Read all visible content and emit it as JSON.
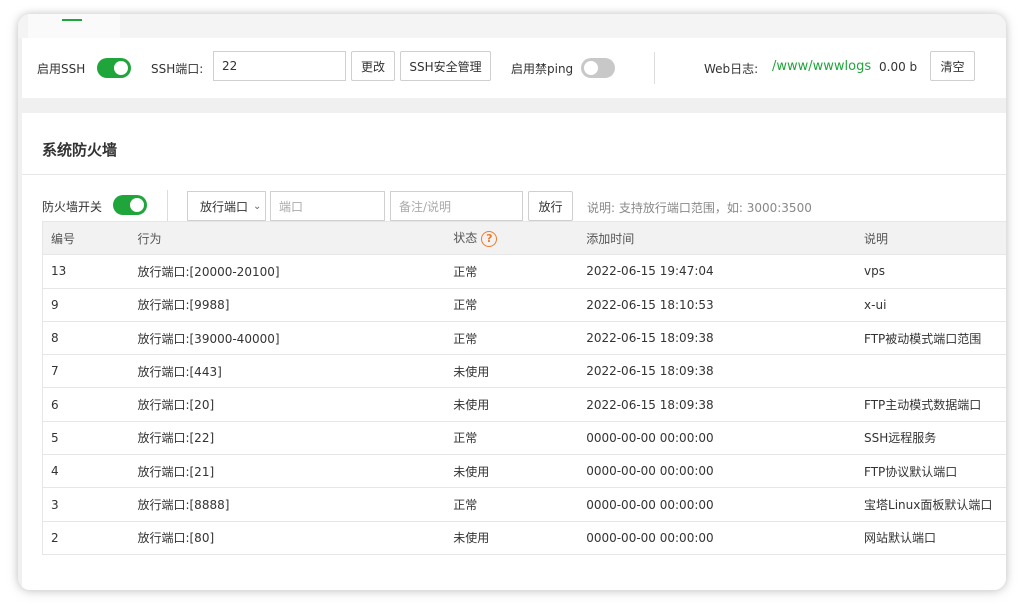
{
  "ssh": {
    "enable_label": "启用SSH",
    "enabled": true,
    "port_label": "SSH端口:",
    "port_value": "22",
    "change_label": "更改",
    "manage_label": "SSH安全管理",
    "ping_label": "启用禁ping",
    "ping_enabled": false
  },
  "weblog": {
    "label": "Web日志:",
    "path": "/www/wwwlogs",
    "size": "0.00 b",
    "clear_label": "清空"
  },
  "firewall": {
    "title": "系统防火墙",
    "switch_label": "防火墙开关",
    "enabled": true,
    "action_select": "放行端口",
    "port_placeholder": "端口",
    "remark_placeholder": "备注/说明",
    "submit_label": "放行",
    "hint": "说明: 支持放行端口范围，如: 3000:3500"
  },
  "table": {
    "headers": [
      "编号",
      "行为",
      "状态",
      "添加时间",
      "说明"
    ],
    "rows": [
      [
        "13",
        "放行端口:[20000-20100]",
        "正常",
        "2022-06-15 19:47:04",
        "vps"
      ],
      [
        "9",
        "放行端口:[9988]",
        "正常",
        "2022-06-15 18:10:53",
        "x-ui"
      ],
      [
        "8",
        "放行端口:[39000-40000]",
        "正常",
        "2022-06-15 18:09:38",
        "FTP被动模式端口范围"
      ],
      [
        "7",
        "放行端口:[443]",
        "未使用",
        "2022-06-15 18:09:38",
        ""
      ],
      [
        "6",
        "放行端口:[20]",
        "未使用",
        "2022-06-15 18:09:38",
        "FTP主动模式数据端口"
      ],
      [
        "5",
        "放行端口:[22]",
        "正常",
        "0000-00-00 00:00:00",
        "SSH远程服务"
      ],
      [
        "4",
        "放行端口:[21]",
        "未使用",
        "0000-00-00 00:00:00",
        "FTP协议默认端口"
      ],
      [
        "3",
        "放行端口:[8888]",
        "正常",
        "0000-00-00 00:00:00",
        "宝塔Linux面板默认端口"
      ],
      [
        "2",
        "放行端口:[80]",
        "未使用",
        "0000-00-00 00:00:00",
        "网站默认端口"
      ]
    ]
  },
  "colors": {
    "accent": "#20a53a",
    "help": "#f07a2a"
  }
}
